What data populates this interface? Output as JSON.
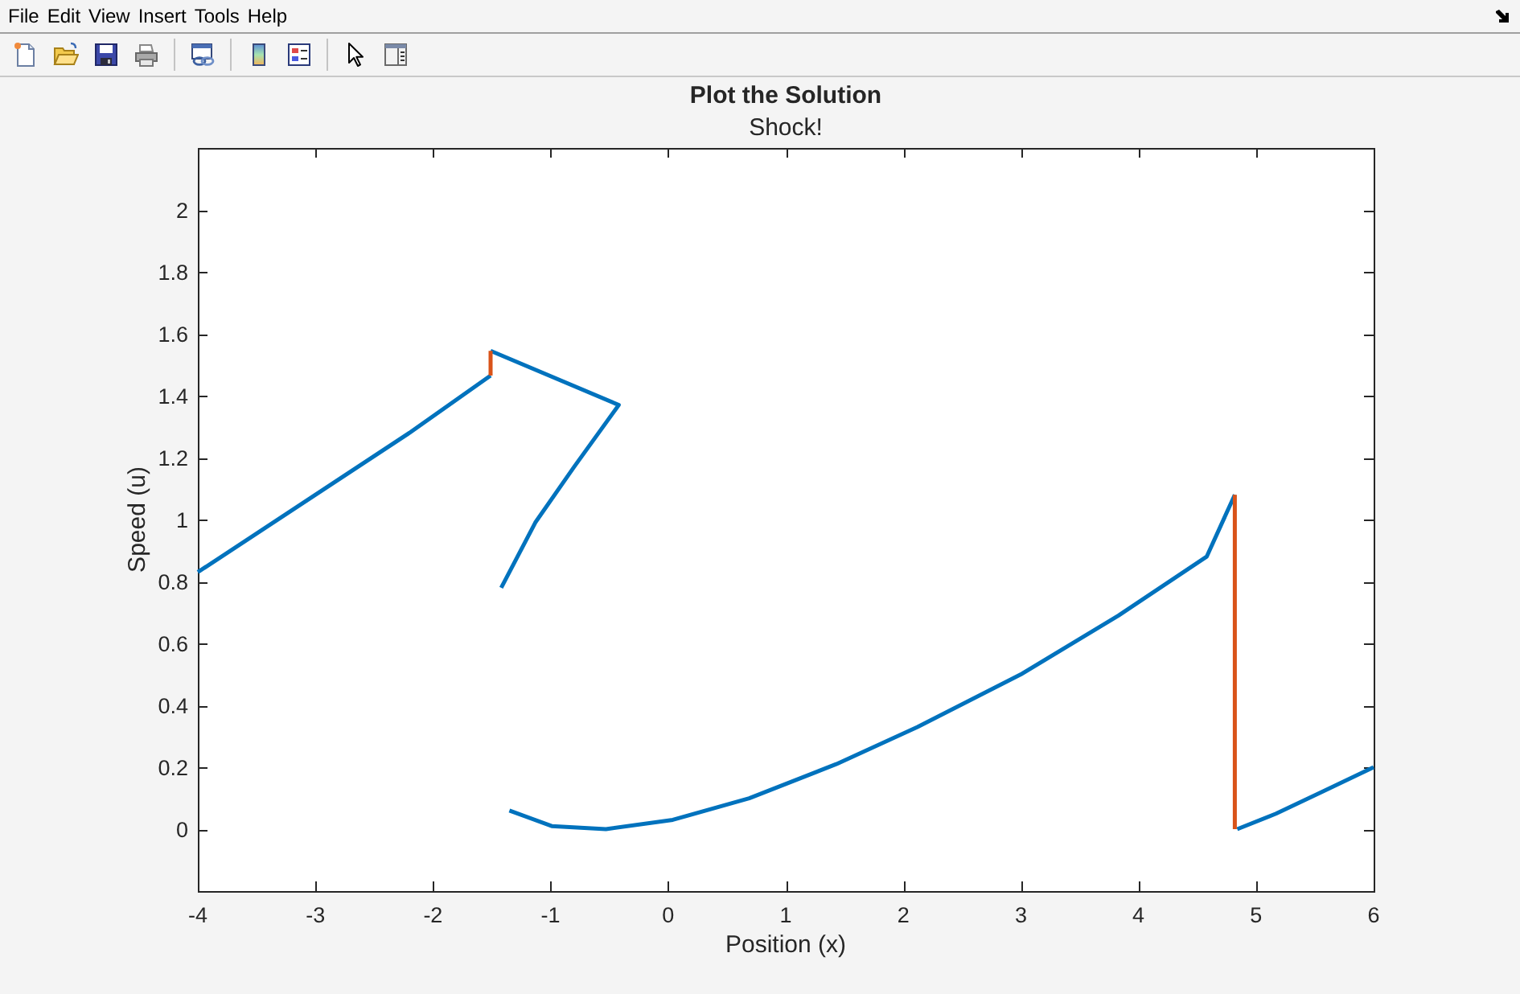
{
  "menu_bar": {
    "items": [
      "File",
      "Edit",
      "View",
      "Insert",
      "Tools",
      "Help"
    ]
  },
  "figure": {
    "title": "Plot the Solution"
  },
  "axes": {
    "chart_data": {
      "type": "line",
      "title": "Shock!",
      "xlabel": "Position (x)",
      "ylabel": "Speed (u)",
      "xlim": [
        -4,
        6
      ],
      "ylim": [
        -0.2,
        2.2
      ],
      "xticks": [
        -4,
        -3,
        -2,
        -1,
        0,
        1,
        2,
        3,
        4,
        5,
        6
      ],
      "yticks": [
        0,
        0.2,
        0.4,
        0.6,
        0.8,
        1,
        1.2,
        1.4,
        1.6,
        1.8,
        2
      ],
      "series": [
        {
          "color": "#0072bd",
          "x": [
            -4,
            -2.2,
            -1.51,
            null,
            -1.51,
            -0.42,
            -0.8,
            -1.13,
            -1.42,
            null,
            -1.35,
            -0.99,
            -0.53,
            0.04,
            0.69,
            1.43,
            2.12,
            3.0,
            3.83,
            4.58,
            4.82,
            null,
            4.84,
            5.17,
            5.56,
            6.0
          ],
          "values": [
            0.83,
            1.28,
            1.465,
            null,
            1.545,
            1.37,
            1.17,
            0.99,
            0.78,
            null,
            0.06,
            0.01,
            0.0,
            0.03,
            0.1,
            0.21,
            0.33,
            0.5,
            0.69,
            0.88,
            1.08,
            null,
            0.0,
            0.05,
            0.12,
            0.2
          ]
        },
        {
          "color": "#d95319",
          "x": [
            -1.51,
            -1.51,
            null,
            4.82,
            4.82
          ],
          "values": [
            1.465,
            1.545,
            null,
            1.08,
            0.0
          ]
        }
      ]
    }
  }
}
